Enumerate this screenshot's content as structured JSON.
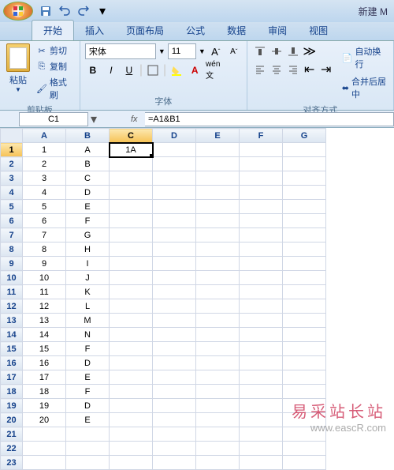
{
  "title": "新建 M",
  "qat": {
    "save_icon": "save-icon",
    "undo_icon": "undo-icon",
    "redo_icon": "redo-icon"
  },
  "tabs": [
    "开始",
    "插入",
    "页面布局",
    "公式",
    "数据",
    "审阅",
    "视图"
  ],
  "active_tab": 0,
  "ribbon": {
    "clipboard": {
      "label": "剪贴板",
      "paste": "粘贴",
      "cut": "剪切",
      "copy": "复制",
      "format_painter": "格式刷"
    },
    "font": {
      "label": "字体",
      "name": "宋体",
      "size": "11",
      "grow": "A",
      "shrink": "A",
      "bold": "B",
      "italic": "I",
      "underline": "U"
    },
    "alignment": {
      "label": "对齐方式",
      "wrap": "自动换行",
      "merge": "合并后居中"
    }
  },
  "name_box": "C1",
  "formula": "=A1&B1",
  "columns": [
    "A",
    "B",
    "C",
    "D",
    "E",
    "F",
    "G"
  ],
  "selected_col": 2,
  "selected_row": 0,
  "row_count": 23,
  "cells": {
    "A": [
      "1",
      "2",
      "3",
      "4",
      "5",
      "6",
      "7",
      "8",
      "9",
      "10",
      "11",
      "12",
      "13",
      "14",
      "15",
      "16",
      "17",
      "18",
      "19",
      "20"
    ],
    "B": [
      "A",
      "B",
      "C",
      "D",
      "E",
      "F",
      "G",
      "H",
      "I",
      "J",
      "K",
      "L",
      "M",
      "N",
      "F",
      "D",
      "E",
      "F",
      "D",
      "E"
    ],
    "C": [
      "1A"
    ]
  },
  "watermark": {
    "line1": "易采站长站",
    "line2": "www.eascR.com"
  }
}
